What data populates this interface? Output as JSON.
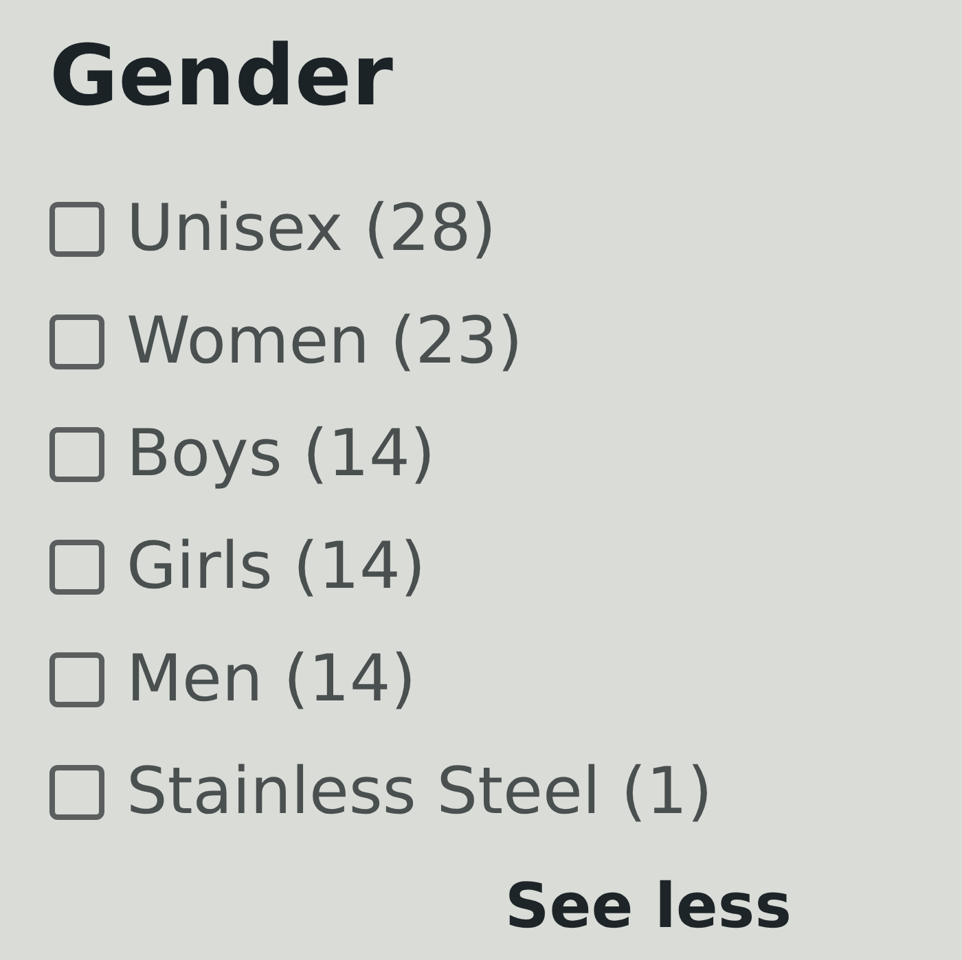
{
  "filter": {
    "title": "Gender",
    "options": [
      {
        "label": "Unisex (28)",
        "checked": false
      },
      {
        "label": "Women (23)",
        "checked": false
      },
      {
        "label": "Boys (14)",
        "checked": false
      },
      {
        "label": "Girls (14)",
        "checked": false
      },
      {
        "label": "Men (14)",
        "checked": false
      },
      {
        "label": "Stainless Steel (1)",
        "checked": false
      }
    ],
    "toggle": "See less"
  }
}
